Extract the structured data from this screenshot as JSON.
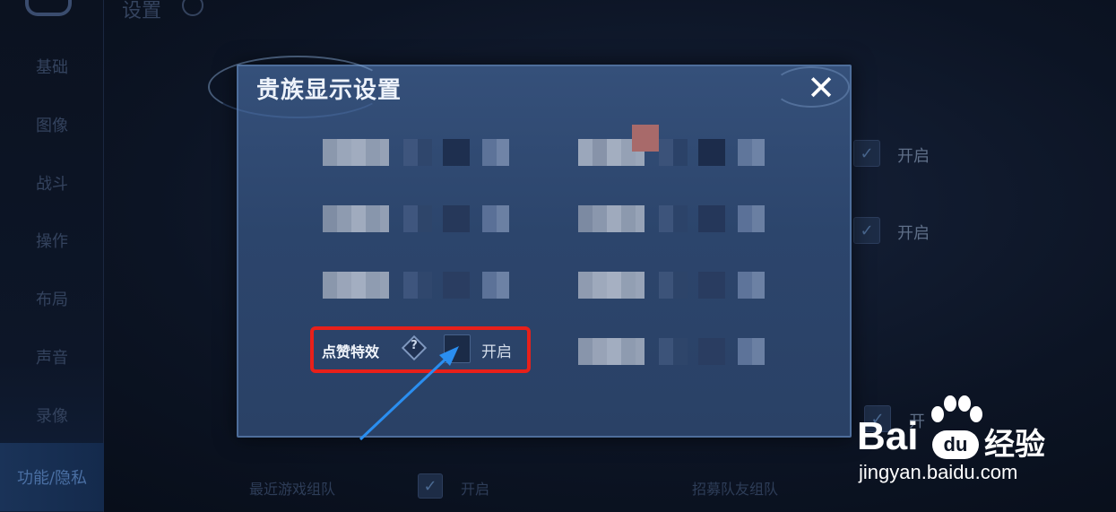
{
  "page": {
    "title": "设置"
  },
  "sidebar": {
    "items": [
      {
        "label": "基础"
      },
      {
        "label": "图像"
      },
      {
        "label": "战斗"
      },
      {
        "label": "操作"
      },
      {
        "label": "布局"
      },
      {
        "label": "声音"
      },
      {
        "label": "录像"
      },
      {
        "label": "功能/隐私",
        "active": true
      }
    ]
  },
  "background": {
    "toggles": [
      {
        "label": "开启",
        "checked": true
      },
      {
        "label": "开启",
        "checked": true
      },
      {
        "label": "开",
        "checked": true
      }
    ],
    "bottom_row": [
      {
        "label": "最近游戏组队"
      },
      {
        "label": "开启"
      },
      {
        "label": "招募队友组队"
      }
    ]
  },
  "dialog": {
    "title": "贵族显示设置",
    "close_icon": "close-icon",
    "highlighted_option": {
      "label": "点赞特效",
      "help_icon": "help-diamond-icon",
      "toggle_label": "开启",
      "checked": false
    }
  },
  "annotation": {
    "highlight_color": "#e8201a",
    "arrow_color": "#2a8ef0"
  },
  "watermark": {
    "brand_left": "Bai",
    "brand_badge": "du",
    "brand_cn": "经验",
    "url": "jingyan.baidu.com"
  }
}
